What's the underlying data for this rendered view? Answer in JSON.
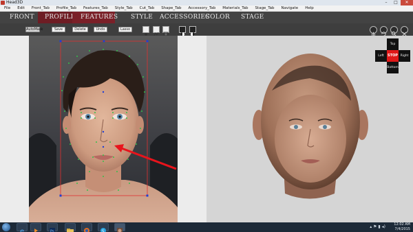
{
  "window": {
    "title": "Head3D"
  },
  "menu": [
    "File",
    "Edit",
    "Front_Tab",
    "Profile_Tab",
    "Features_Tab",
    "Style_Tab",
    "Cut_Tab",
    "Shape_Tab",
    "Accessory_Tab",
    "Materials_Tab",
    "Stage_Tab",
    "Navigate",
    "Help"
  ],
  "tabs": {
    "front": "Front",
    "profile": "Profile",
    "features": "Features",
    "style": "Style",
    "accessories": "Accessories",
    "color": "Color",
    "stage": "Stage"
  },
  "toolbar": {
    "autofit": "AutoMask",
    "save": "Save",
    "delete": "Delete",
    "undo": "Undo",
    "lasso": "Lasso"
  },
  "nav": {
    "top": "Top",
    "left": "Left",
    "stop": "STOP",
    "right": "Right",
    "bottom": "Bottom"
  },
  "taskbar": {
    "time": "12:02 AM",
    "date": "7/4/2015"
  },
  "colors": {
    "tabbar": "#434343",
    "active_tab": "#7a2028",
    "stop": "#e01818",
    "arrow": "#e8141c"
  }
}
